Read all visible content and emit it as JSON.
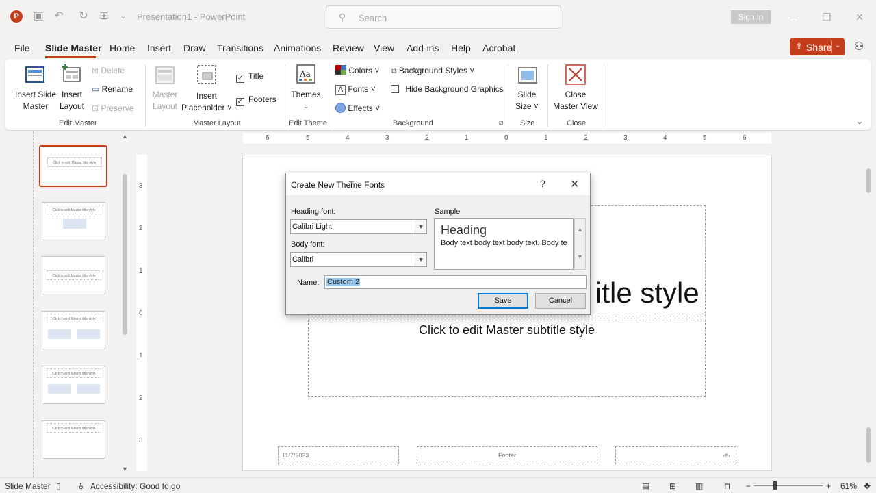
{
  "window": {
    "title": "Presentation1 - PowerPoint",
    "search_placeholder": "Search",
    "sign_in": "Sign in"
  },
  "menu": {
    "items": [
      "File",
      "Slide Master",
      "Home",
      "Insert",
      "Draw",
      "Transitions",
      "Animations",
      "Review",
      "View",
      "Add-ins",
      "Help",
      "Acrobat"
    ],
    "active": "Slide Master",
    "share": "Share"
  },
  "ribbon": {
    "insert_slide_master": [
      "Insert Slide",
      "Master"
    ],
    "insert_layout": [
      "Insert",
      "Layout"
    ],
    "delete": "Delete",
    "rename": "Rename",
    "preserve": "Preserve",
    "group_edit_master": "Edit Master",
    "master_layout": [
      "Master",
      "Layout"
    ],
    "insert_placeholder": [
      "Insert",
      "Placeholder ˅"
    ],
    "title_check": "Title",
    "footers_check": "Footers",
    "group_master_layout": "Master Layout",
    "themes": "Themes",
    "group_edit_theme": "Edit Theme",
    "colors": "Colors ˅",
    "fonts": "Fonts ˅",
    "effects": "Effects ˅",
    "background_styles": "Background Styles ˅",
    "hide_bg_graphics": "Hide Background Graphics",
    "group_background": "Background",
    "slide_size": [
      "Slide",
      "Size ˅"
    ],
    "group_size": "Size",
    "close_master_view": [
      "Close",
      "Master View"
    ],
    "group_close": "Close"
  },
  "thumbnails": {
    "title": "Click to edit Master title style"
  },
  "rulers": {
    "horizontal": [
      "6",
      "5",
      "4",
      "3",
      "2",
      "1",
      "0",
      "1",
      "2",
      "3",
      "4",
      "5",
      "6"
    ],
    "vertical": [
      "3",
      "2",
      "1",
      "0",
      "1",
      "2",
      "3"
    ]
  },
  "slide": {
    "title_visible": "itle style",
    "subtitle": "Click to edit Master subtitle style",
    "date": "11/7/2023",
    "footer": "Footer",
    "slide_number": "‹#›"
  },
  "dialog": {
    "title": "Create New Theme Fonts",
    "help": "?",
    "heading_font_label": "Heading font:",
    "heading_font_value": "Calibri Light",
    "body_font_label": "Body font:",
    "body_font_value": "Calibri",
    "sample_label": "Sample",
    "sample_heading": "Heading",
    "sample_body": "Body text body text body text. Body te",
    "name_label": "Name:",
    "name_value": "Custom 2",
    "save": "Save",
    "cancel": "Cancel"
  },
  "status": {
    "view": "Slide Master",
    "accessibility": "Accessibility: Good to go",
    "zoom": "61%"
  },
  "colors": {
    "accent": "#c43e1c",
    "selection": "#99c9ef",
    "default_button_border": "#0078d7"
  }
}
